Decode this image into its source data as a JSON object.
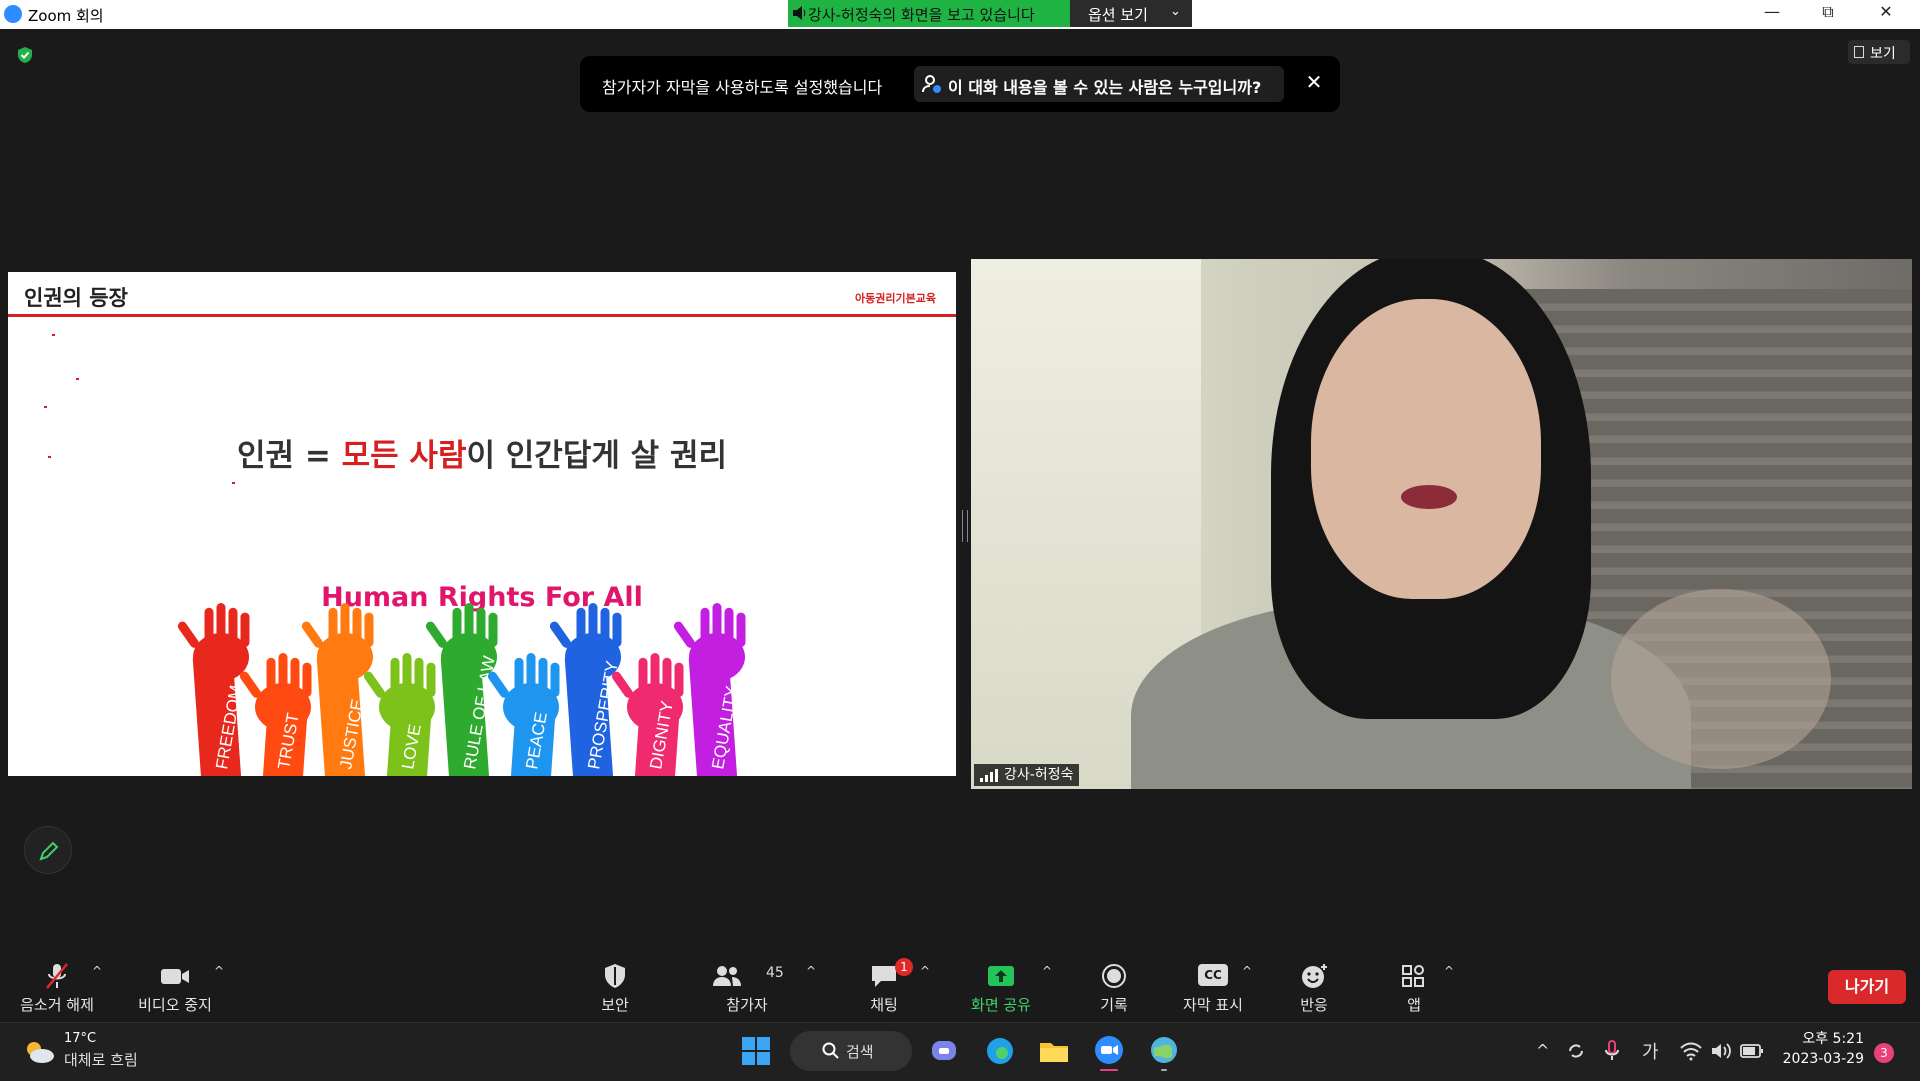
{
  "titlebar": {
    "app_title": "Zoom 회의",
    "share_banner": "강사-허정숙의 화면을 보고 있습니다",
    "options_label": "옵션 보기"
  },
  "view_button": {
    "label": "보기"
  },
  "caption_notice": {
    "message": "참가자가 자막을 사용하도록 설정했습니다",
    "who_link": "이 대화 내용을 볼 수 있는 사람은 누구입니까?"
  },
  "slide": {
    "title": "인권의 등장",
    "org": "아동권리기본교육",
    "headline_pre": "인권 = ",
    "headline_red": "모든 사람",
    "headline_post": "이 인간답게 살 권리",
    "banner": "Human Rights For All",
    "hand_words": [
      {
        "text": "FREEDOM",
        "color": "#e8271d"
      },
      {
        "text": "TRUST",
        "color": "#ff4b12"
      },
      {
        "text": "JUSTICE",
        "color": "#ff7a10"
      },
      {
        "text": "LOVE",
        "color": "#7cc21a"
      },
      {
        "text": "RULE OF LAW",
        "color": "#2eaa2e"
      },
      {
        "text": "PEACE",
        "color": "#1e96f0"
      },
      {
        "text": "PROSPERITY",
        "color": "#1f63e0"
      },
      {
        "text": "DIGNITY",
        "color": "#ef2a6e"
      },
      {
        "text": "EQUALITY",
        "color": "#c21fe0"
      }
    ]
  },
  "video": {
    "participant_name": "강사-허정숙"
  },
  "toolbar": {
    "mute": "음소거 해제",
    "video": "비디오 중지",
    "security": "보안",
    "participants": "참가자",
    "participants_count": "45",
    "chat": "채팅",
    "chat_badge": "1",
    "share": "화면 공유",
    "record": "기록",
    "captions": "자막 표시",
    "cc_icon_text": "CC",
    "reactions": "반응",
    "apps": "앱",
    "leave": "나가기"
  },
  "taskbar": {
    "temperature": "17°C",
    "weather": "대체로 흐림",
    "search": "검색",
    "ime": "가",
    "time": "오후 5:21",
    "date": "2023-03-29",
    "notifications": "3"
  }
}
